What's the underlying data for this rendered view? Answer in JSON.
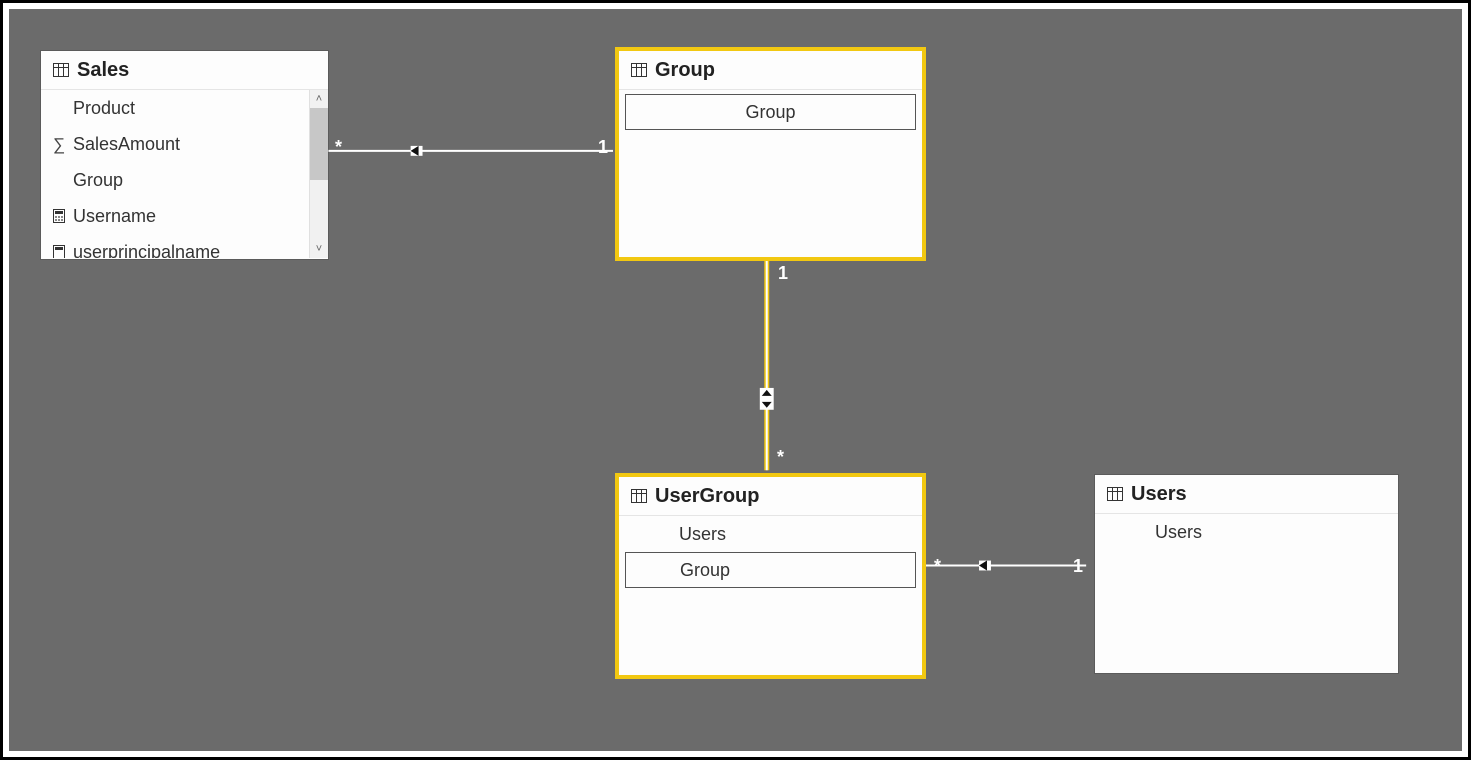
{
  "tables": {
    "sales": {
      "title": "Sales",
      "fields": {
        "product": {
          "label": "Product",
          "icon": null
        },
        "amount": {
          "label": "SalesAmount",
          "icon": "sigma"
        },
        "group": {
          "label": "Group",
          "icon": null
        },
        "username": {
          "label": "Username",
          "icon": "calc"
        },
        "upn": {
          "label": "userprincipalname",
          "icon": "calc"
        }
      }
    },
    "group": {
      "title": "Group",
      "fields": {
        "group": {
          "label": "Group"
        }
      }
    },
    "usergroup": {
      "title": "UserGroup",
      "fields": {
        "users": {
          "label": "Users"
        },
        "group": {
          "label": "Group"
        }
      }
    },
    "users": {
      "title": "Users",
      "fields": {
        "users": {
          "label": "Users"
        }
      }
    }
  },
  "relationships": {
    "sales_group": {
      "from": "*",
      "to": "1",
      "filter": "single"
    },
    "group_usergroup": {
      "from": "1",
      "to": "*",
      "filter": "both"
    },
    "usergroup_users": {
      "from": "*",
      "to": "1",
      "filter": "single"
    }
  }
}
